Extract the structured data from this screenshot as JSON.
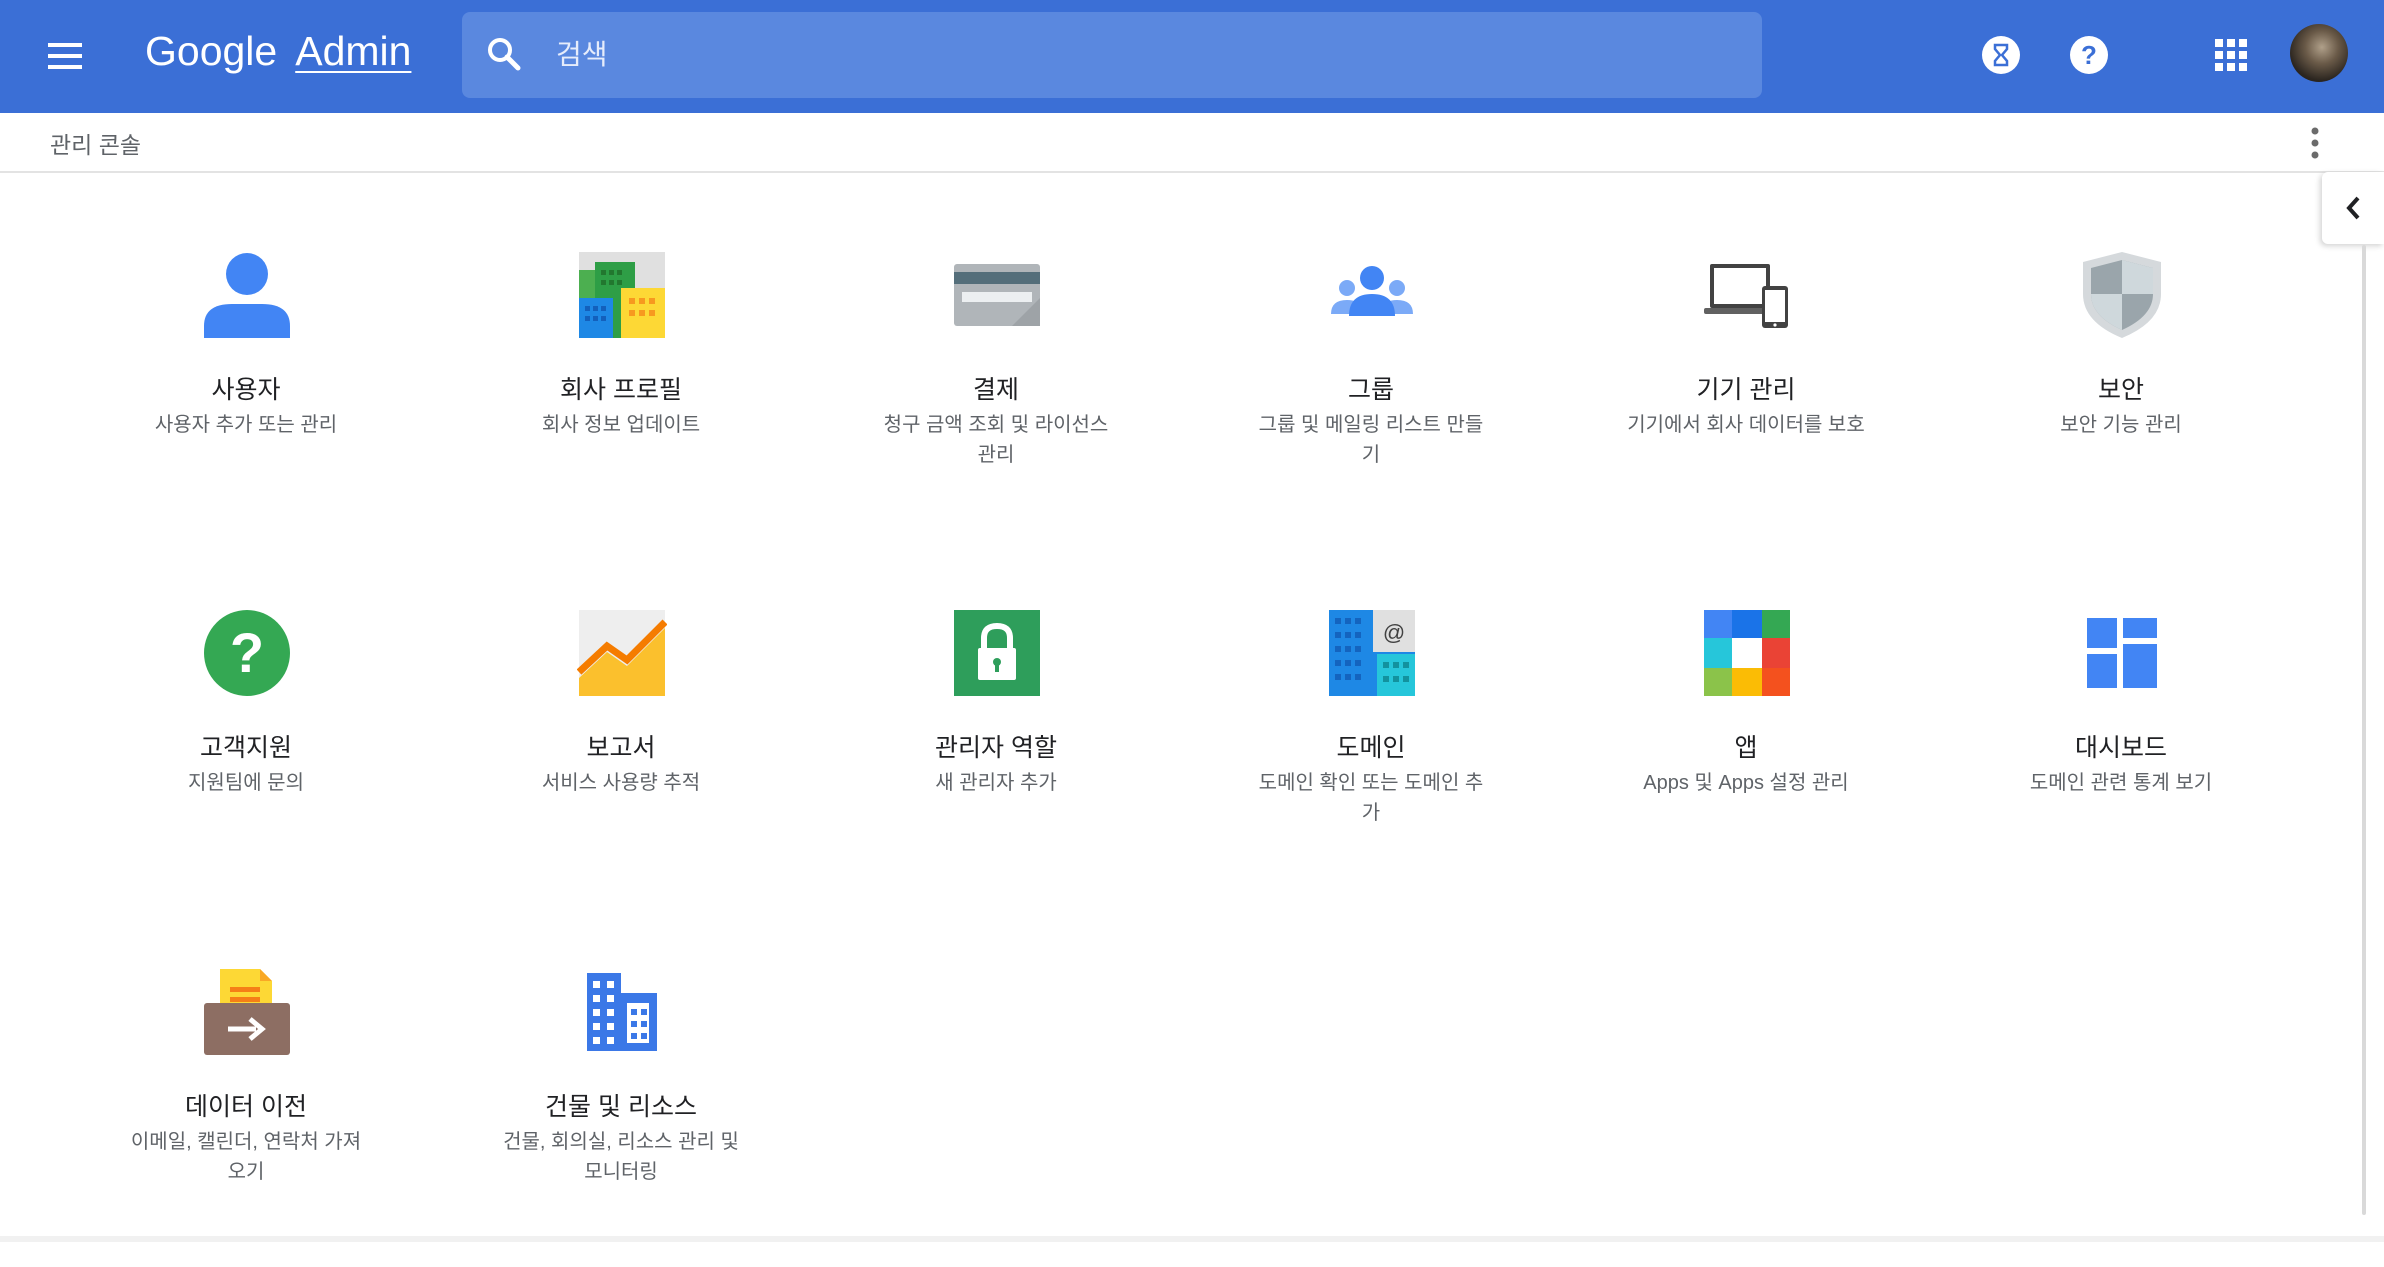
{
  "header": {
    "logo_google": "Google",
    "logo_admin": "Admin",
    "search_placeholder": "검색"
  },
  "subbar": {
    "breadcrumb": "관리 콘솔"
  },
  "tiles": [
    {
      "title": "사용자",
      "desc": "사용자 추가 또는 관리",
      "icon": "user-icon"
    },
    {
      "title": "회사 프로필",
      "desc": "회사 정보 업데이트",
      "icon": "company-profile-icon"
    },
    {
      "title": "결제",
      "desc": "청구 금액 조회 및 라이선스 관리",
      "icon": "billing-card-icon"
    },
    {
      "title": "그룹",
      "desc": "그룹 및 메일링 리스트 만들기",
      "icon": "groups-icon"
    },
    {
      "title": "기기 관리",
      "desc": "기기에서 회사 데이터를 보호",
      "icon": "devices-icon"
    },
    {
      "title": "보안",
      "desc": "보안 기능 관리",
      "icon": "security-shield-icon"
    },
    {
      "title": "고객지원",
      "desc": "지원팀에 문의",
      "icon": "support-question-icon"
    },
    {
      "title": "보고서",
      "desc": "서비스 사용량 추적",
      "icon": "reports-chart-icon"
    },
    {
      "title": "관리자 역할",
      "desc": "새 관리자 추가",
      "icon": "admin-roles-lock-icon"
    },
    {
      "title": "도메인",
      "desc": "도메인 확인 또는 도메인 추가",
      "icon": "domains-icon"
    },
    {
      "title": "앱",
      "desc": "Apps 및 Apps 설정 관리",
      "icon": "apps-grid-icon"
    },
    {
      "title": "대시보드",
      "desc": "도메인 관련 통계 보기",
      "icon": "dashboard-icon"
    },
    {
      "title": "데이터 이전",
      "desc": "이메일, 캘린더, 연락처 가져오기",
      "icon": "data-migration-icon"
    },
    {
      "title": "건물 및 리소스",
      "desc": "건물, 회의실, 리소스 관리 및 모니터링",
      "icon": "buildings-resources-icon"
    }
  ]
}
